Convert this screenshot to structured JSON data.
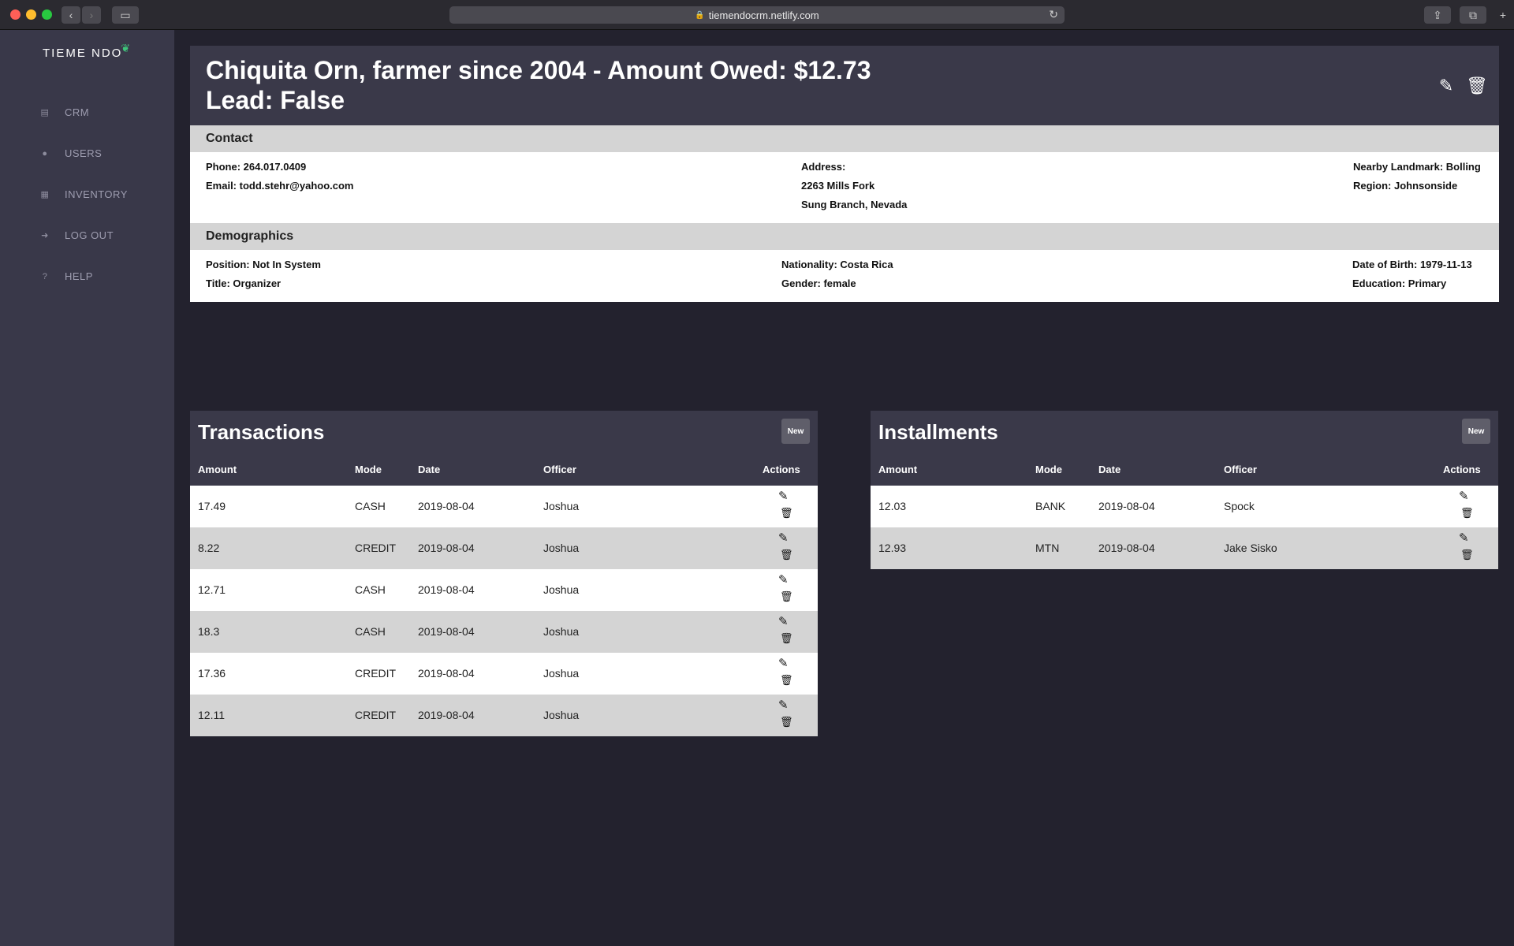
{
  "browser": {
    "url": "tiemendocrm.netlify.com"
  },
  "sidebar": {
    "logo": "TIEME NDO",
    "items": [
      {
        "label": "CRM",
        "icon": "database-icon"
      },
      {
        "label": "USERS",
        "icon": "user-icon"
      },
      {
        "label": "INVENTORY",
        "icon": "cubes-icon"
      },
      {
        "label": "LOG OUT",
        "icon": "sign-out-icon"
      },
      {
        "label": "HELP",
        "icon": "question-circle-icon"
      }
    ]
  },
  "profile": {
    "title_line1": "Chiquita Orn, farmer since 2004 - Amount Owed: $12.73",
    "title_line2": "Lead: False",
    "contact": {
      "heading": "Contact",
      "phone": "Phone: 264.017.0409",
      "email": "Email: todd.stehr@yahoo.com",
      "address_label": "Address:",
      "address_line1": "2263 Mills Fork",
      "address_line2": "Sung Branch, Nevada",
      "landmark": "Nearby Landmark: Bolling",
      "region": "Region: Johnsonside"
    },
    "demographics": {
      "heading": "Demographics",
      "position": "Position: Not In System",
      "title": "Title: Organizer",
      "nationality": "Nationality: Costa Rica",
      "gender": "Gender: female",
      "dob": "Date of Birth: 1979-11-13",
      "education": "Education: Primary"
    }
  },
  "transactions": {
    "title": "Transactions",
    "new_label": "New",
    "columns": [
      "Amount",
      "Mode",
      "Date",
      "Officer",
      "Actions"
    ],
    "rows": [
      {
        "amount": "17.49",
        "mode": "CASH",
        "date": "2019-08-04",
        "officer": "Joshua"
      },
      {
        "amount": "8.22",
        "mode": "CREDIT",
        "date": "2019-08-04",
        "officer": "Joshua"
      },
      {
        "amount": "12.71",
        "mode": "CASH",
        "date": "2019-08-04",
        "officer": "Joshua"
      },
      {
        "amount": "18.3",
        "mode": "CASH",
        "date": "2019-08-04",
        "officer": "Joshua"
      },
      {
        "amount": "17.36",
        "mode": "CREDIT",
        "date": "2019-08-04",
        "officer": "Joshua"
      },
      {
        "amount": "12.11",
        "mode": "CREDIT",
        "date": "2019-08-04",
        "officer": "Joshua"
      }
    ]
  },
  "installments": {
    "title": "Installments",
    "new_label": "New",
    "columns": [
      "Amount",
      "Mode",
      "Date",
      "Officer",
      "Actions"
    ],
    "rows": [
      {
        "amount": "12.03",
        "mode": "BANK",
        "date": "2019-08-04",
        "officer": "Spock"
      },
      {
        "amount": "12.93",
        "mode": "MTN",
        "date": "2019-08-04",
        "officer": "Jake Sisko"
      }
    ]
  }
}
